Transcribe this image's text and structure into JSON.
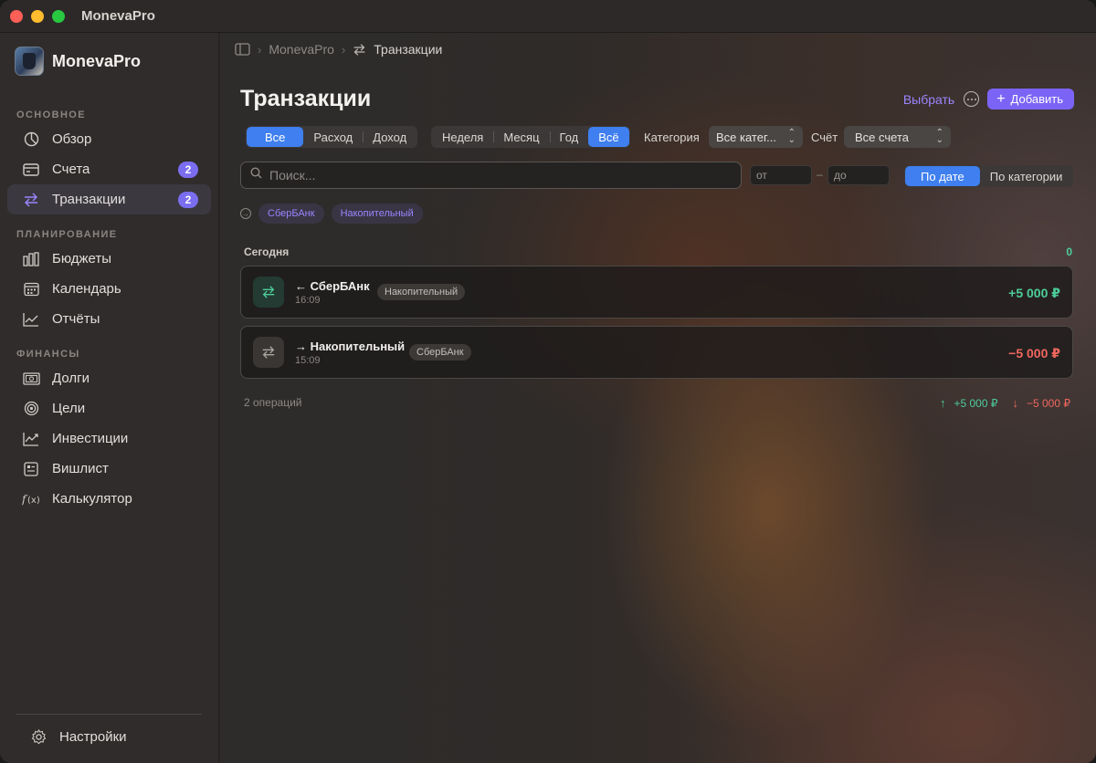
{
  "app": {
    "title": "MonevaPro",
    "brand": "MonevaPro"
  },
  "sidebar": {
    "sections": [
      {
        "title": "ОСНОВНОЕ",
        "items": [
          {
            "label": "Обзор",
            "icon": "chart-pie-icon"
          },
          {
            "label": "Счета",
            "icon": "card-icon",
            "badge": "2"
          },
          {
            "label": "Транзакции",
            "icon": "arrows-exchange-icon",
            "badge": "2",
            "active": true
          }
        ]
      },
      {
        "title": "ПЛАНИРОВАНИЕ",
        "items": [
          {
            "label": "Бюджеты",
            "icon": "bars-icon"
          },
          {
            "label": "Календарь",
            "icon": "calendar-icon"
          },
          {
            "label": "Отчёты",
            "icon": "line-chart-icon"
          }
        ]
      },
      {
        "title": "ФИНАНСЫ",
        "items": [
          {
            "label": "Долги",
            "icon": "banknote-icon"
          },
          {
            "label": "Цели",
            "icon": "target-icon"
          },
          {
            "label": "Инвестиции",
            "icon": "trend-icon"
          },
          {
            "label": "Вишлист",
            "icon": "list-icon"
          },
          {
            "label": "Калькулятор",
            "icon": "function-icon"
          }
        ]
      }
    ],
    "settings": "Настройки"
  },
  "breadcrumb": {
    "root": "MonevaPro",
    "current": "Транзакции"
  },
  "page": {
    "title": "Транзакции",
    "select_label": "Выбрать",
    "add_label": "Добавить"
  },
  "filters": {
    "type": [
      "Все",
      "Расход",
      "Доход"
    ],
    "type_selected": "Все",
    "period": [
      "Неделя",
      "Месяц",
      "Год",
      "Всё"
    ],
    "period_selected": "Всё",
    "category_label": "Категория",
    "category_value": "Все катег...",
    "account_label": "Счёт",
    "account_value": "Все счета",
    "search_placeholder": "Поиск...",
    "date_from_placeholder": "от",
    "date_to_placeholder": "до",
    "date_dash": "–",
    "sort": [
      "По дате",
      "По категории"
    ],
    "sort_selected": "По дате"
  },
  "chips": [
    "СберБАнк",
    "Накопительный"
  ],
  "group": {
    "title": "Сегодня",
    "count": "0"
  },
  "transactions": [
    {
      "title": "← СберБАнк",
      "time": "16:09",
      "tag": "Накопительный",
      "amount": "+5 000 ₽",
      "direction": "in"
    },
    {
      "title": "→ Накопительный",
      "time": "15:09",
      "tag": "СберБАнк",
      "amount": "−5 000 ₽",
      "direction": "out"
    }
  ],
  "footer": {
    "count": "2 операций",
    "income": "+5 000 ₽",
    "expense": "−5 000 ₽"
  },
  "colors": {
    "accent": "#7b64f5",
    "selected_segment": "#3f7fef",
    "income": "#4ccd99",
    "expense": "#f0675e"
  }
}
